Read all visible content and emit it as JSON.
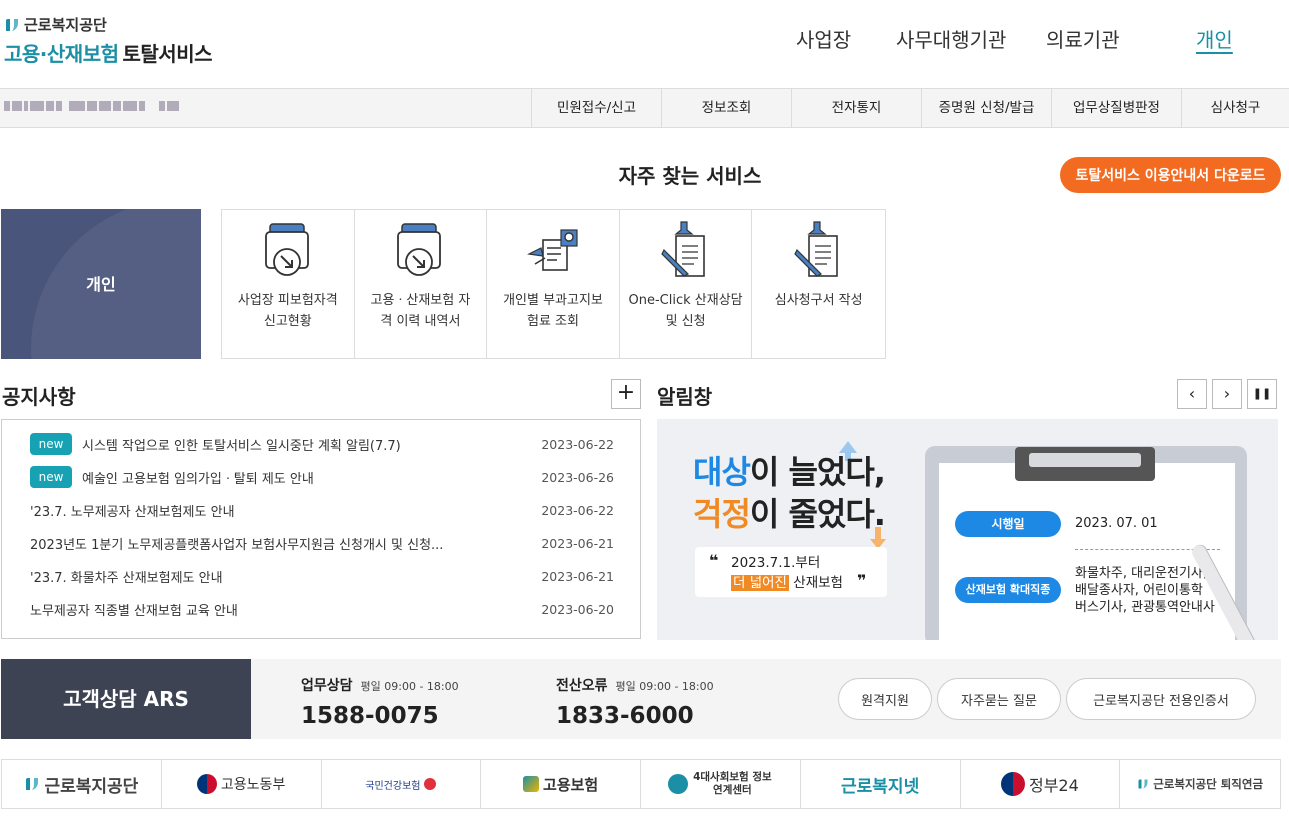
{
  "brand": {
    "org": "근로복지공단",
    "service_teal": "고용·산재보험",
    "service_dark": "토탈서비스"
  },
  "top_nav": {
    "items": [
      "사업장",
      "사무대행기관",
      "의료기관",
      "개인"
    ],
    "active": "개인"
  },
  "sub_nav": {
    "items": [
      "민원접수/신고",
      "정보조회",
      "전자통지",
      "증명원 신청/발급",
      "업무상질병판정",
      "심사청구"
    ]
  },
  "favorites": {
    "title": "자주 찾는 서비스",
    "guide_button": "토탈서비스 이용안내서 다운로드",
    "category": "개인",
    "services": [
      {
        "line1": "사업장 피보험자격",
        "line2": "신고현황",
        "icon": "document-arrow-icon"
      },
      {
        "line1": "고용ㆍ산재보험 자",
        "line2": "격 이력 내역서",
        "icon": "document-arrow-icon"
      },
      {
        "line1": "개인별 부과고지보",
        "line2": "험료 조회",
        "icon": "document-search-icon"
      },
      {
        "line1": "One-Click 산재상담",
        "line2": "및 신청",
        "icon": "document-pen-icon"
      },
      {
        "line1": "심사청구서 작성",
        "line2": "",
        "icon": "document-pen-icon"
      }
    ]
  },
  "notices": {
    "title": "공지사항",
    "more_button": "+",
    "items": [
      {
        "new": "new",
        "text": "시스템 작업으로 인한 토탈서비스 일시중단 계획 알림(7.7)",
        "date": "2023-06-22"
      },
      {
        "new": "new",
        "text": "예술인 고용보험 임의가입ㆍ탈퇴 제도 안내",
        "date": "2023-06-26"
      },
      {
        "new": "",
        "text": "'23.7. 노무제공자 산재보험제도 안내",
        "date": "2023-06-22"
      },
      {
        "new": "",
        "text": "2023년도 1분기 노무제공플랫폼사업자 보험사무지원금 신청개시 및 신청...",
        "date": "2023-06-21"
      },
      {
        "new": "",
        "text": "'23.7. 화물차주 산재보험제도 안내",
        "date": "2023-06-21"
      },
      {
        "new": "",
        "text": "노무제공자 직종별 산재보험 교육 안내",
        "date": "2023-06-20"
      }
    ]
  },
  "alerts": {
    "title": "알림창",
    "prev": "‹",
    "next": "›",
    "pause": "❚❚",
    "banner": {
      "h1_a_blue": "대상",
      "h1_a_rest": "이 늘었다,",
      "h1_b_orange": "걱정",
      "h1_b_rest": "이 줄었다.",
      "quote_line1": "2023.7.1.부터",
      "quote_highlight": "더 넓어진",
      "quote_rest": " 산재보험",
      "quote_open": "❝",
      "quote_close": "❞",
      "pill1": "시행일",
      "value1": "2023. 07. 01",
      "pill2": "산재보험 확대직종",
      "value2_l1": "화물차주, 대리운전기사,",
      "value2_l2": "배달종사자, 어린이통학",
      "value2_l3": "버스기사, 관광통역안내사"
    }
  },
  "ars": {
    "title": "고객상담 ARS",
    "items": [
      {
        "name": "업무상담",
        "hours": "평일 09:00 - 18:00",
        "phone": "1588-0075"
      },
      {
        "name": "전산오류",
        "hours": "평일 09:00 - 18:00",
        "phone": "1833-6000"
      }
    ],
    "buttons": [
      "원격지원",
      "자주묻는 질문",
      "근로복지공단 전용인증서"
    ]
  },
  "partner_logos": [
    "근로복지공단",
    "고용노동부",
    "국민건강보험",
    "고용보험",
    "4대사회보험 정보연계센터",
    "근로복지넷",
    "정부24",
    "근로복지공단 퇴직연금"
  ],
  "colors": {
    "teal": "#1a8fa6",
    "orange": "#f26b21",
    "navy": "#4a557c",
    "badge": "#17a2b4",
    "blue": "#1e88e5"
  }
}
